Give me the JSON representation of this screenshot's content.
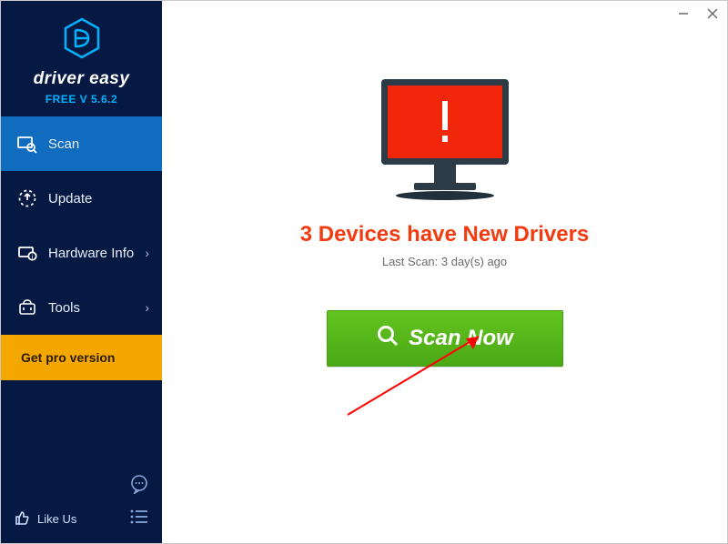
{
  "brand": {
    "name": "driver easy",
    "version_label": "FREE V 5.6.2"
  },
  "nav": {
    "scan": "Scan",
    "update": "Update",
    "hardware": "Hardware Info",
    "tools": "Tools",
    "pro": "Get pro version"
  },
  "bottom": {
    "like": "Like Us"
  },
  "main": {
    "headline": "3 Devices have New Drivers",
    "last_scan": "Last Scan: 3 day(s) ago",
    "scan_button": "Scan Now"
  }
}
